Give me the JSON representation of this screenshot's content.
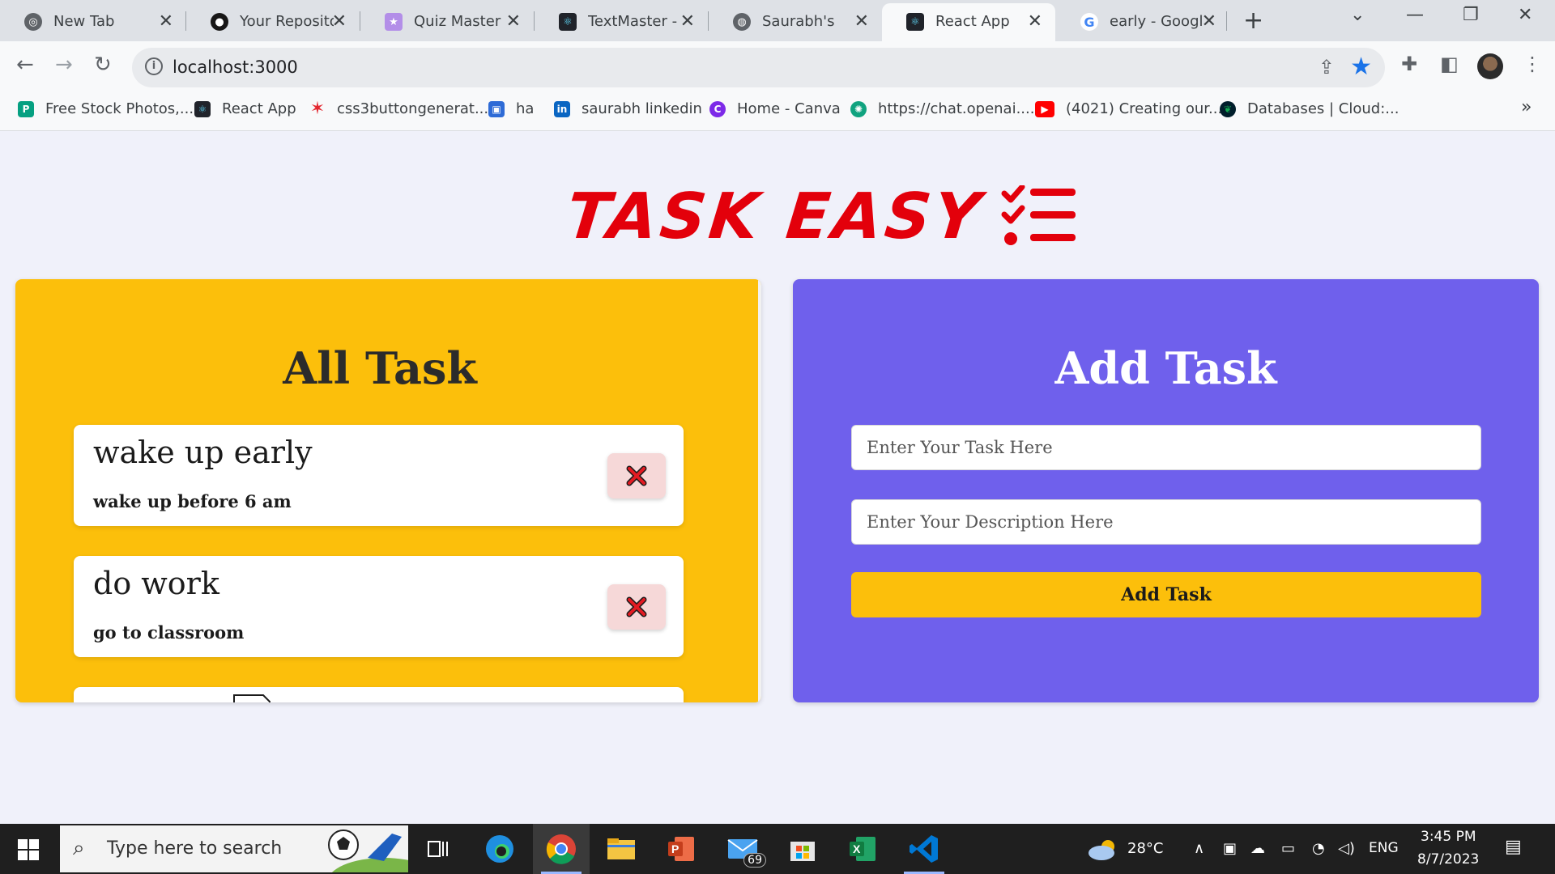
{
  "browser": {
    "tabs": [
      {
        "title": "New Tab",
        "icon": "chrome-icon",
        "color": "#5f6368"
      },
      {
        "title": "Your Repositor",
        "icon": "github-icon",
        "color": "#181717"
      },
      {
        "title": "Quiz Master",
        "icon": "quiz-icon",
        "color": "#b38ee8"
      },
      {
        "title": "TextMaster - H",
        "icon": "react-icon",
        "color": "#20232a"
      },
      {
        "title": "Saurabh's",
        "icon": "globe-icon",
        "color": "#5f6368"
      },
      {
        "title": "React App",
        "icon": "react-icon",
        "color": "#20232a",
        "active": true
      },
      {
        "title": "early - Google",
        "icon": "google-icon",
        "color": "#4285f4"
      }
    ],
    "url": "localhost:3000",
    "bookmarks": [
      {
        "label": "Free Stock Photos,...",
        "color": "#05a081"
      },
      {
        "label": "React App",
        "color": "#20232a"
      },
      {
        "label": "css3buttongenerat...",
        "color": "#e3262e"
      },
      {
        "label": "ha",
        "color": "#2e6bd6"
      },
      {
        "label": "saurabh linkedin",
        "color": "#0a66c2"
      },
      {
        "label": "Home - Canva",
        "color": "#7d2ae8"
      },
      {
        "label": "https://chat.openai....",
        "color": "#10a37f"
      },
      {
        "label": "(4021) Creating our...",
        "color": "#ff0000"
      },
      {
        "label": "Databases | Cloud:...",
        "color": "#13aa52"
      }
    ]
  },
  "app": {
    "logo_text": "TASK EASY",
    "logo_color": "#e3000b",
    "all_tasks_heading": "All Task",
    "add_task_heading": "Add Task",
    "tasks": [
      {
        "title": "wake up early",
        "description": "wake up before 6 am"
      },
      {
        "title": "do work",
        "description": "go to classroom"
      }
    ],
    "task_input_placeholder": "Enter Your Task Here",
    "description_input_placeholder": "Enter Your Description Here",
    "add_button_label": "Add Task",
    "left_panel_color": "#fcbf0b",
    "right_panel_color": "#6f60ec"
  },
  "taskbar": {
    "search_placeholder": "Type here to search",
    "weather": "28°C",
    "language": "ENG",
    "time": "3:45 PM",
    "date": "8/7/2023",
    "mail_badge": "69"
  }
}
